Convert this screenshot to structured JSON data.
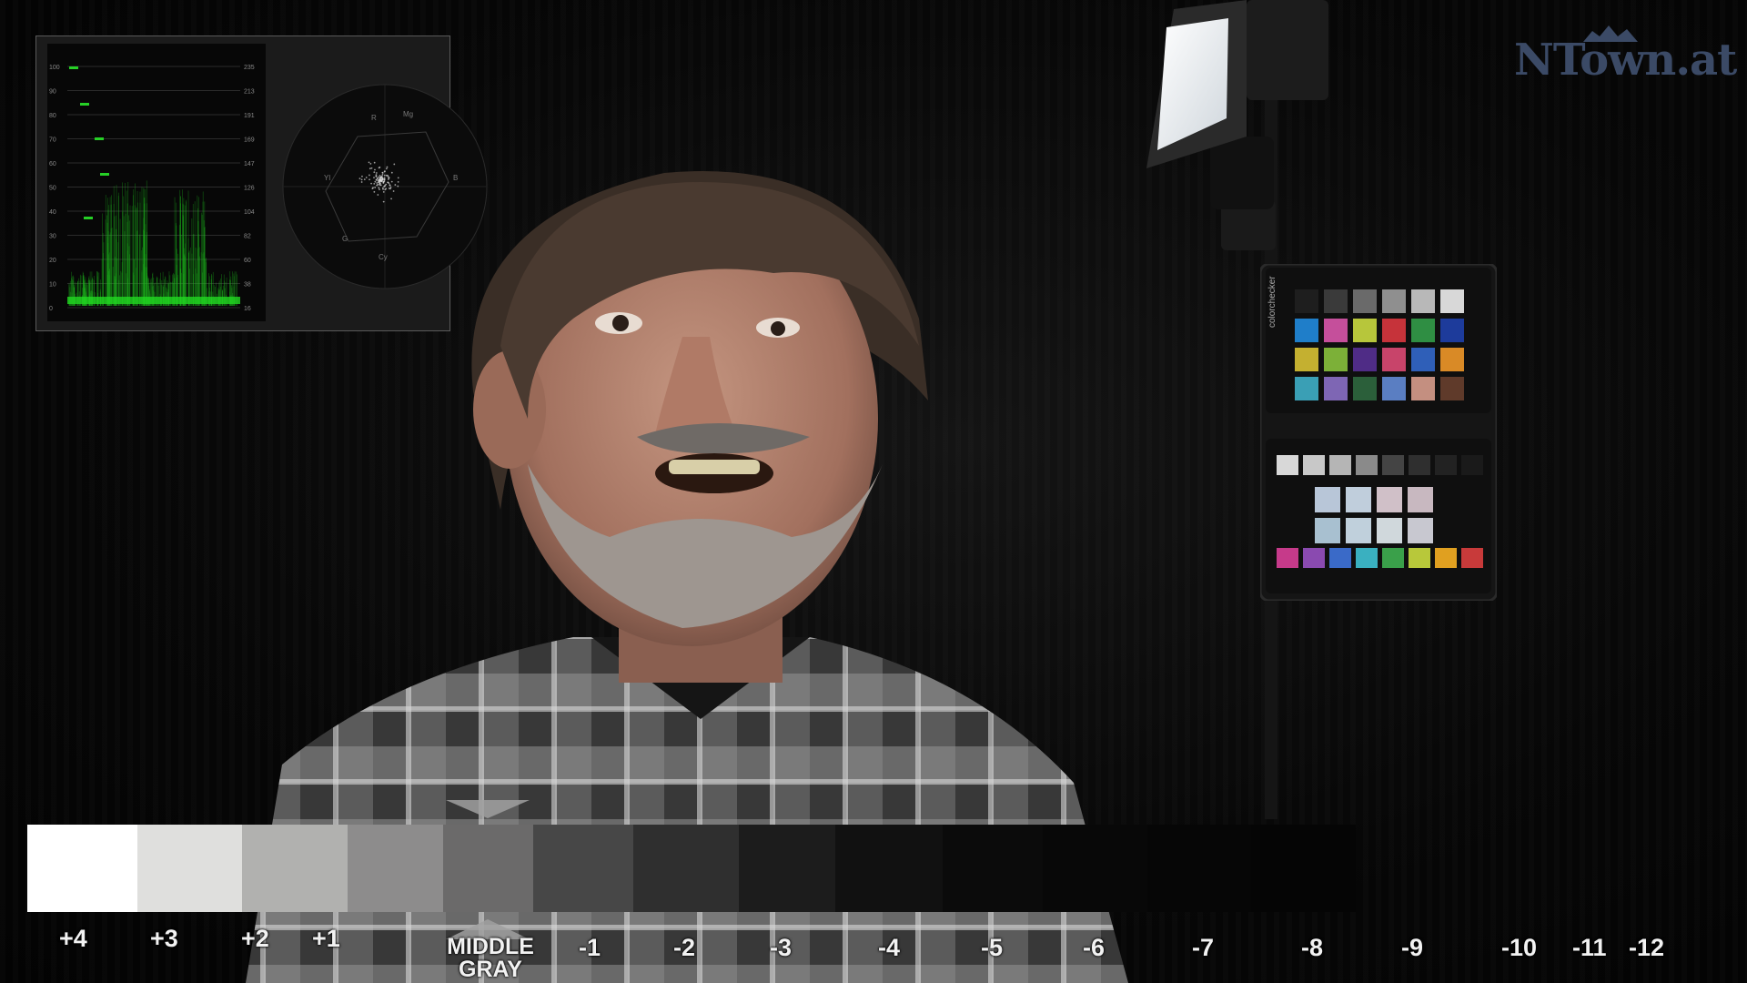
{
  "logo": {
    "text": "NTown.at",
    "color": "#3b4a66"
  },
  "scopes": {
    "waveform_left_ticks": [
      "100",
      "90",
      "80",
      "70",
      "60",
      "50",
      "40",
      "30",
      "20",
      "10",
      "0"
    ],
    "waveform_right_ticks": [
      "235",
      "213",
      "191",
      "169",
      "147",
      "126",
      "104",
      "82",
      "60",
      "38",
      "16"
    ],
    "vectorscope_labels": [
      "R",
      "Mg",
      "B",
      "Cy",
      "G",
      "Yl"
    ]
  },
  "exposure_scale": {
    "stops": [
      {
        "label": "+4",
        "color": "#ffffff"
      },
      {
        "label": "+3",
        "color": "#dfdfdd"
      },
      {
        "label": "+2",
        "color": "#b1b1af"
      },
      {
        "label": "+1",
        "color": "#8d8c8c"
      },
      {
        "label": "MIDDLE GRAY",
        "color": "#6b6a6a"
      },
      {
        "label": "-1",
        "color": "#474747"
      },
      {
        "label": "-2",
        "color": "#2f2f2f"
      },
      {
        "label": "-3",
        "color": "#1c1c1c"
      },
      {
        "label": "-4",
        "color": "#111111"
      },
      {
        "label": "-5",
        "color": "#0b0b0b"
      },
      {
        "label": "-6",
        "color": "#080808"
      },
      {
        "label": "-7",
        "color": "#060606"
      },
      {
        "label": "-8",
        "color": "#050505"
      },
      {
        "label": "-9",
        "color": "#050505"
      },
      {
        "label": "-10",
        "color": "#050505"
      },
      {
        "label": "-11",
        "color": "#050505"
      },
      {
        "label": "-12",
        "color": "#050505"
      }
    ],
    "middle_label_line1": "MIDDLE",
    "middle_label_line2": "GRAY"
  },
  "checker": {
    "brand": "colorchecker",
    "top_swatches": [
      "#1e1e1e",
      "#3a3a3a",
      "#6a6a6a",
      "#8f8f8f",
      "#b8b8b8",
      "#d8d8d8",
      "#1f7ec9",
      "#c54f9b",
      "#b7c63b",
      "#c6333a",
      "#2f8e43",
      "#1d3b9b",
      "#c4b030",
      "#7cb038",
      "#4f2c86",
      "#c8446a",
      "#2f5fb8",
      "#d98a26",
      "#3a9fb5",
      "#7e66b4",
      "#2b5f3a",
      "#5a7ec2",
      "#c48f80",
      "#5f3a2a"
    ],
    "bottom_swatches": [
      "#d8d8d8",
      "#c8c8c8",
      "#b5b5b5",
      "#8a8a8a",
      "#444444",
      "#2f2f2f",
      "#222222",
      "#1a1a1a",
      "#b8c6d8",
      "#c0cedc",
      "#d0c0c8",
      "#c8b8c0",
      "#a8c0d0",
      "#c0d0dc",
      "#d0d8dc",
      "#c8c8d0",
      "#c63a8a",
      "#8a4ab0",
      "#3a6ac8",
      "#3ab0c0",
      "#3aa04a",
      "#b8c83a",
      "#e0a020",
      "#c83a3a"
    ]
  }
}
